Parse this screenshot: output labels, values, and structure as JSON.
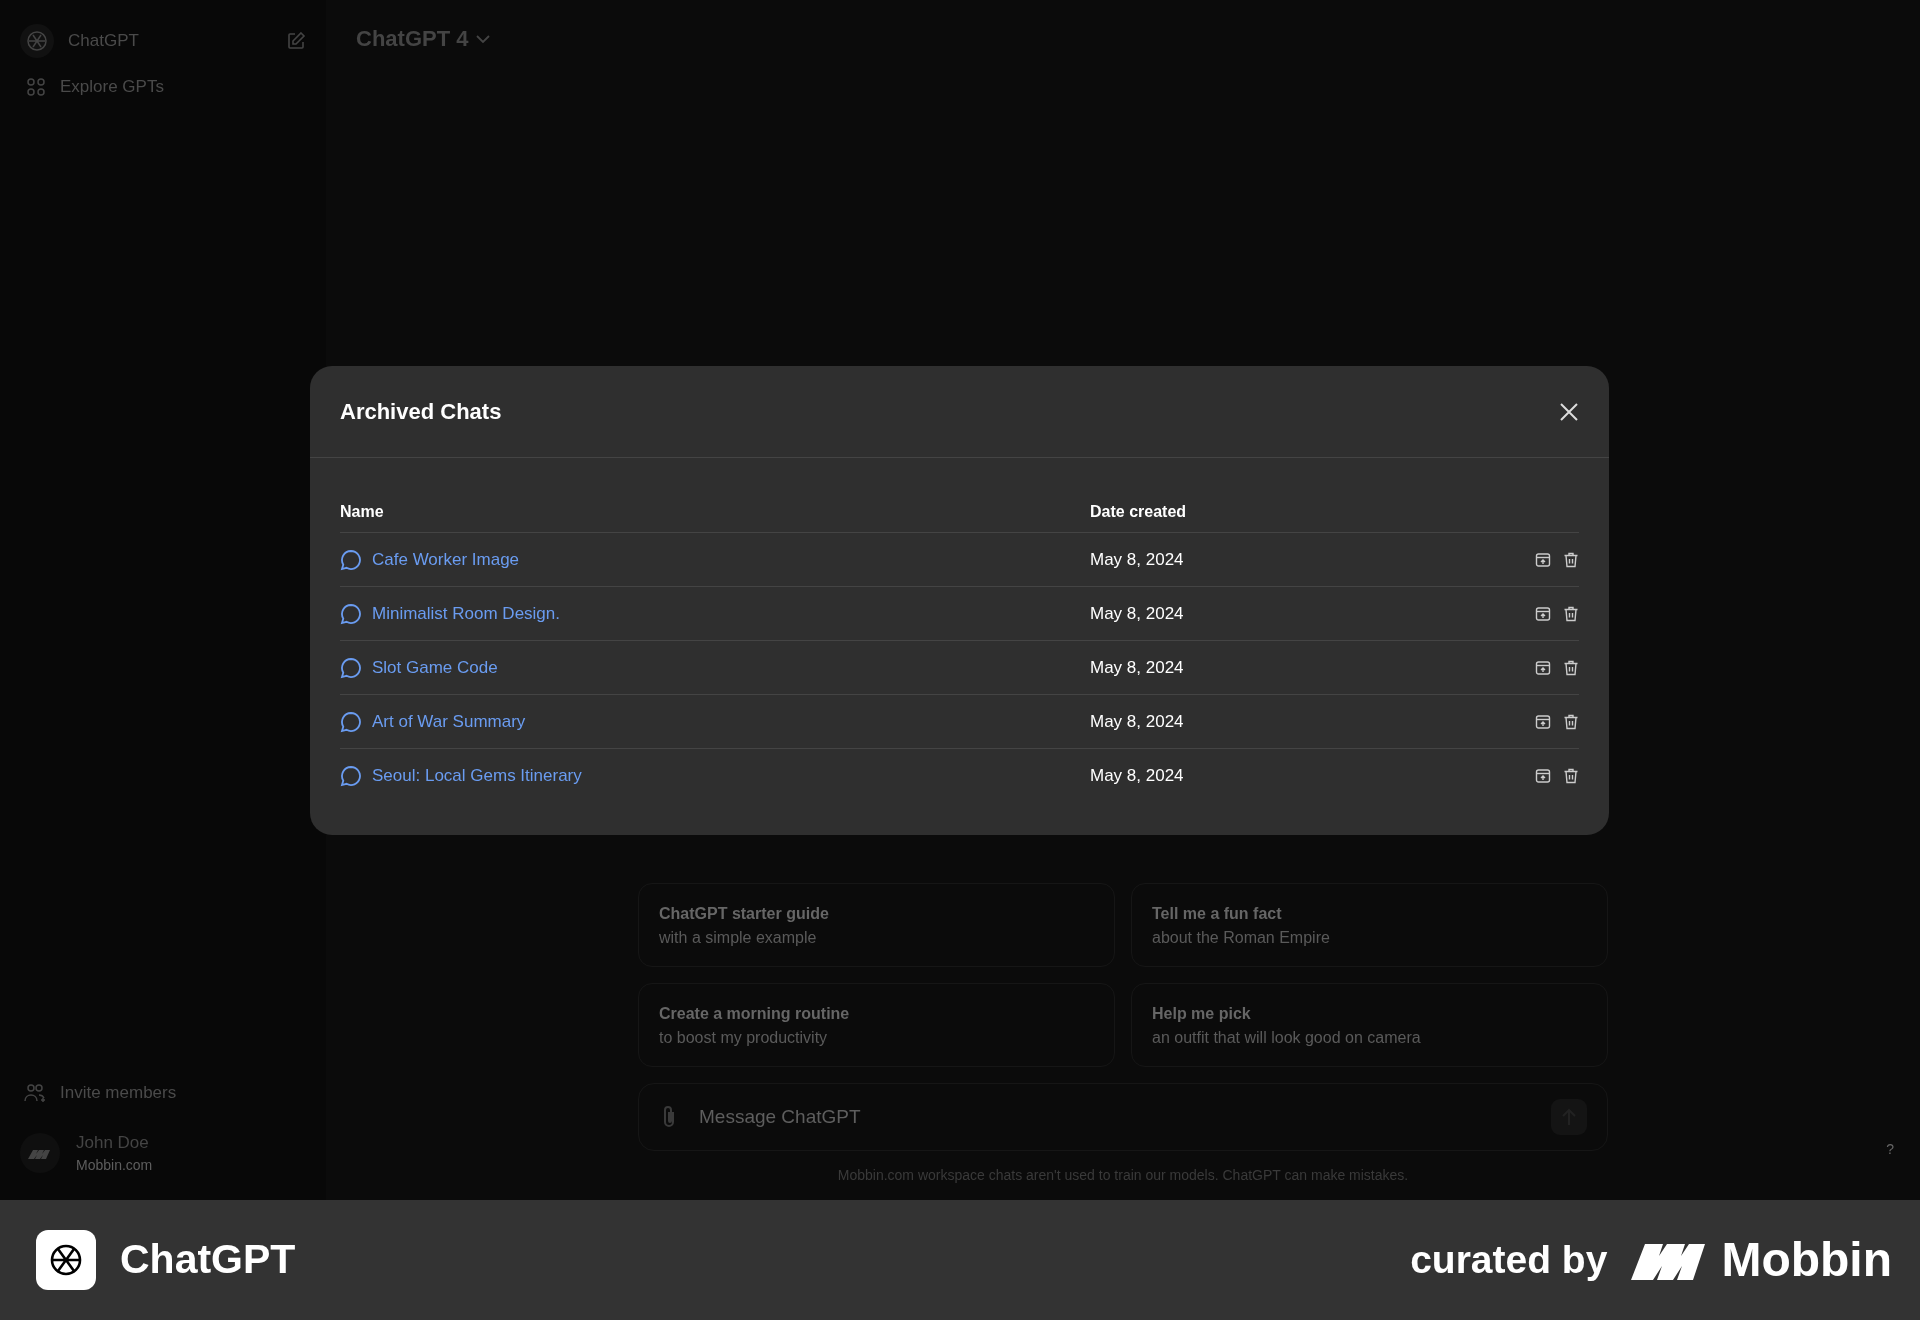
{
  "sidebar": {
    "brand": "ChatGPT",
    "items": [
      {
        "label": "Explore GPTs"
      }
    ],
    "invite": "Invite members",
    "user": {
      "name": "John Doe",
      "org": "Mobbin.com"
    }
  },
  "header": {
    "model": "ChatGPT 4"
  },
  "suggestions": [
    {
      "title": "ChatGPT starter guide",
      "subtitle": "with a simple example"
    },
    {
      "title": "Tell me a fun fact",
      "subtitle": "about the Roman Empire"
    },
    {
      "title": "Create a morning routine",
      "subtitle": "to boost my productivity"
    },
    {
      "title": "Help me pick",
      "subtitle": "an outfit that will look good on camera"
    }
  ],
  "composer": {
    "placeholder": "Message ChatGPT"
  },
  "disclaimer": "Mobbin.com workspace chats aren't used to train our models. ChatGPT can make mistakes.",
  "help": "?",
  "modal": {
    "title": "Archived Chats",
    "columns": [
      "Name",
      "Date created"
    ],
    "rows": [
      {
        "name": "Cafe Worker Image",
        "date": "May 8, 2024"
      },
      {
        "name": "Minimalist Room Design.",
        "date": "May 8, 2024"
      },
      {
        "name": "Slot Game Code",
        "date": "May 8, 2024"
      },
      {
        "name": "Art of War Summary",
        "date": "May 8, 2024"
      },
      {
        "name": "Seoul: Local Gems Itinerary",
        "date": "May 8, 2024"
      }
    ]
  },
  "footer_banner": {
    "app": "ChatGPT",
    "curated": "curated by",
    "brand": "Mobbin"
  }
}
